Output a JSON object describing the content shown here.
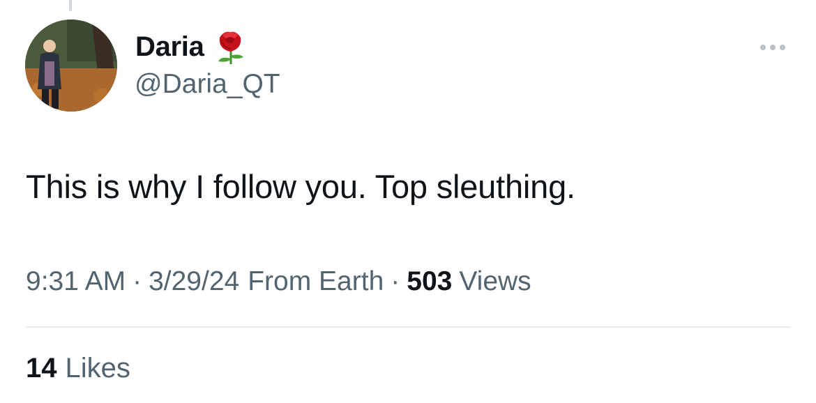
{
  "tweet": {
    "author": {
      "display_name": "Daria",
      "name_emoji": "rose-icon",
      "handle": "@Daria_QT",
      "avatar": "avatar-photo"
    },
    "text": "This is why I follow you. Top sleuthing.",
    "meta": {
      "time": "9:31 AM",
      "separator": "·",
      "date": "3/29/24",
      "source": "From Earth",
      "views_count": "503",
      "views_label": "Views"
    },
    "likes": {
      "count": "14",
      "label": "Likes"
    },
    "more_icon": "more-horizontal-icon"
  },
  "colors": {
    "text_primary": "#0f1419",
    "text_secondary": "#536471",
    "divider": "#e6ecf0",
    "rose": "#d4141c"
  }
}
